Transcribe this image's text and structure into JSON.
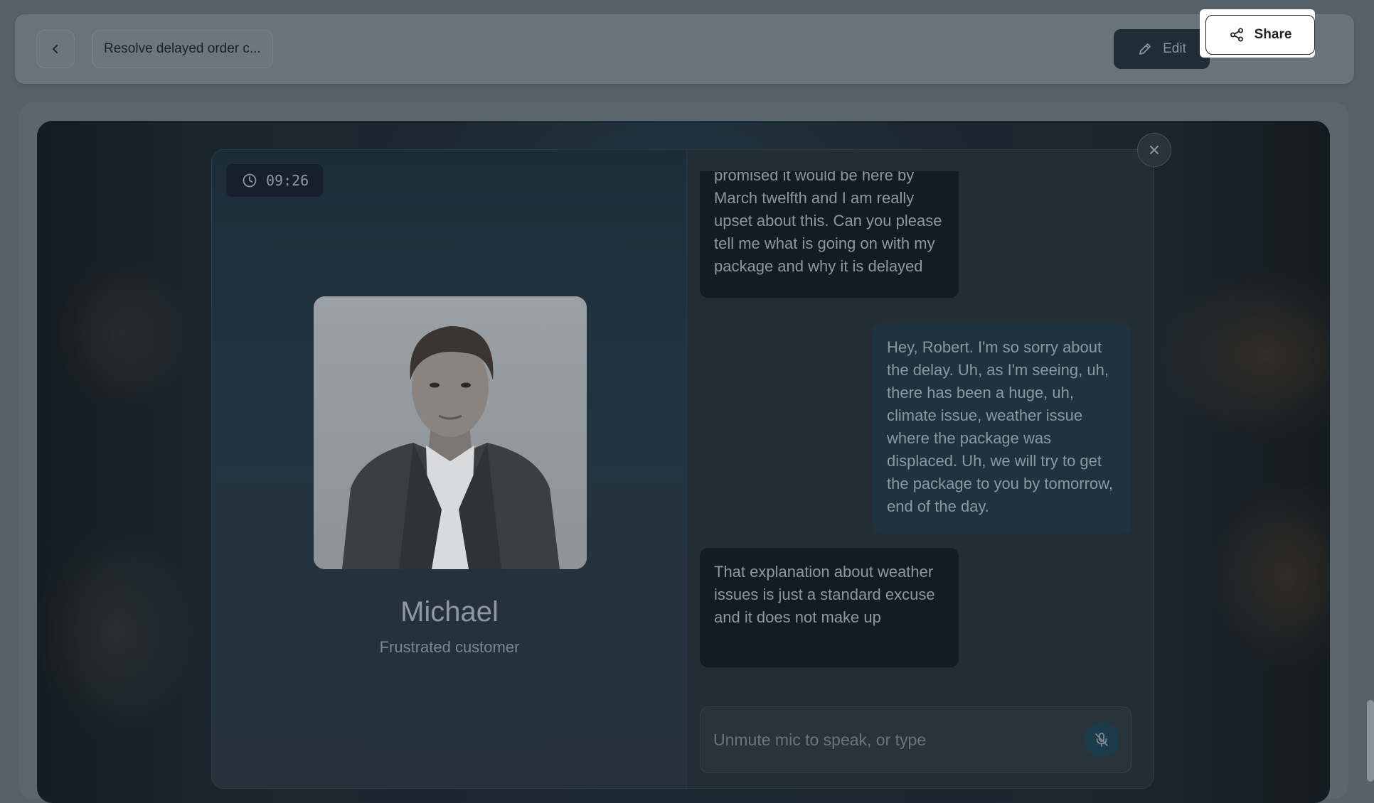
{
  "header": {
    "title": "Resolve delayed order c...",
    "edit_label": "Edit",
    "share_label": "Share"
  },
  "session": {
    "timer": "09:26"
  },
  "persona": {
    "name": "Michael",
    "role": "Frustrated customer"
  },
  "messages": [
    {
      "sender": "customer",
      "text": "promised it would be here by March twelfth and I am really upset about this. Can you please tell me what is going on with my package and why it is delayed"
    },
    {
      "sender": "agent",
      "text": "Hey, Robert. I'm so sorry about the delay. Uh, as I'm seeing, uh, there has been a huge, uh, climate issue, weather issue where the package was displaced. Uh, we will try to get the package to you by tomorrow, end of the day."
    },
    {
      "sender": "customer",
      "text": "That explanation about weather issues is just a standard excuse and it does not make up"
    }
  ],
  "composer": {
    "placeholder": "Unmute mic to speak, or type",
    "value": ""
  },
  "icons": {
    "back": "chevron-left-icon",
    "edit": "pencil-icon",
    "share": "share-icon",
    "timer": "clock-icon",
    "close": "close-icon",
    "mic": "mic-off-icon"
  },
  "colors": {
    "edit_button_bg": "#1f2d36",
    "share_button_bg": "#ffffff",
    "agent_bubble": "#1d3440",
    "customer_bubble": "#121c23"
  }
}
